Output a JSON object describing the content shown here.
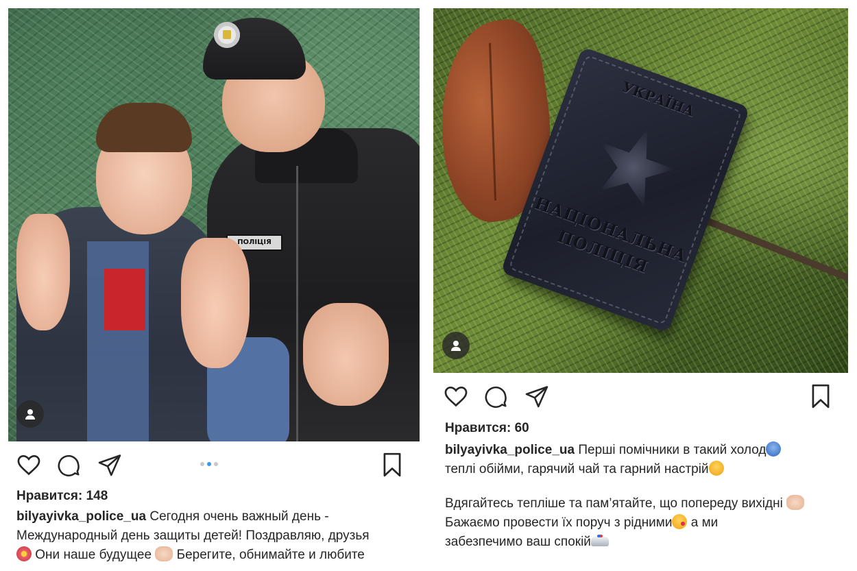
{
  "posts": [
    {
      "likes": "Нравится: 148",
      "username": "bilyayivka_police_ua",
      "caption_lines": [
        "Сегодня очень важный день -",
        "Международный день защиты детей! Поздравляю, друзья",
        "Они наше будущее",
        "Берегите, обнимайте и любите"
      ],
      "photo_text": {
        "patch": "ПОЛІЦІЯ"
      },
      "carousel": {
        "total": 3,
        "active_index": 1
      },
      "icons": [
        "heart-icon",
        "comment-icon",
        "share-icon",
        "bookmark-icon",
        "user-tag-icon"
      ]
    },
    {
      "likes": "Нравится: 60",
      "username": "bilyayivka_police_ua",
      "caption_lines": [
        "Перші помічники в такий холод",
        "теплі обійми, гарячий чай та гарний настрій",
        "Вдягайтесь тепліше та пам’ятайте, що попереду вихідні",
        "Бажаємо провести їх поруч з рідними",
        "а ми",
        "забезпечимо ваш спокій"
      ],
      "photo_text": {
        "wallet_top": "УКРАЇНА",
        "wallet_mid": "НАЦІОНАЛЬНА",
        "wallet_bottom": "ПОЛІЦІЯ"
      },
      "icons": [
        "heart-icon",
        "comment-icon",
        "share-icon",
        "bookmark-icon",
        "user-tag-icon"
      ]
    }
  ],
  "colors": {
    "text": "#262626",
    "carousel_active": "#3897f0",
    "carousel_inactive": "#c7c7c7"
  }
}
